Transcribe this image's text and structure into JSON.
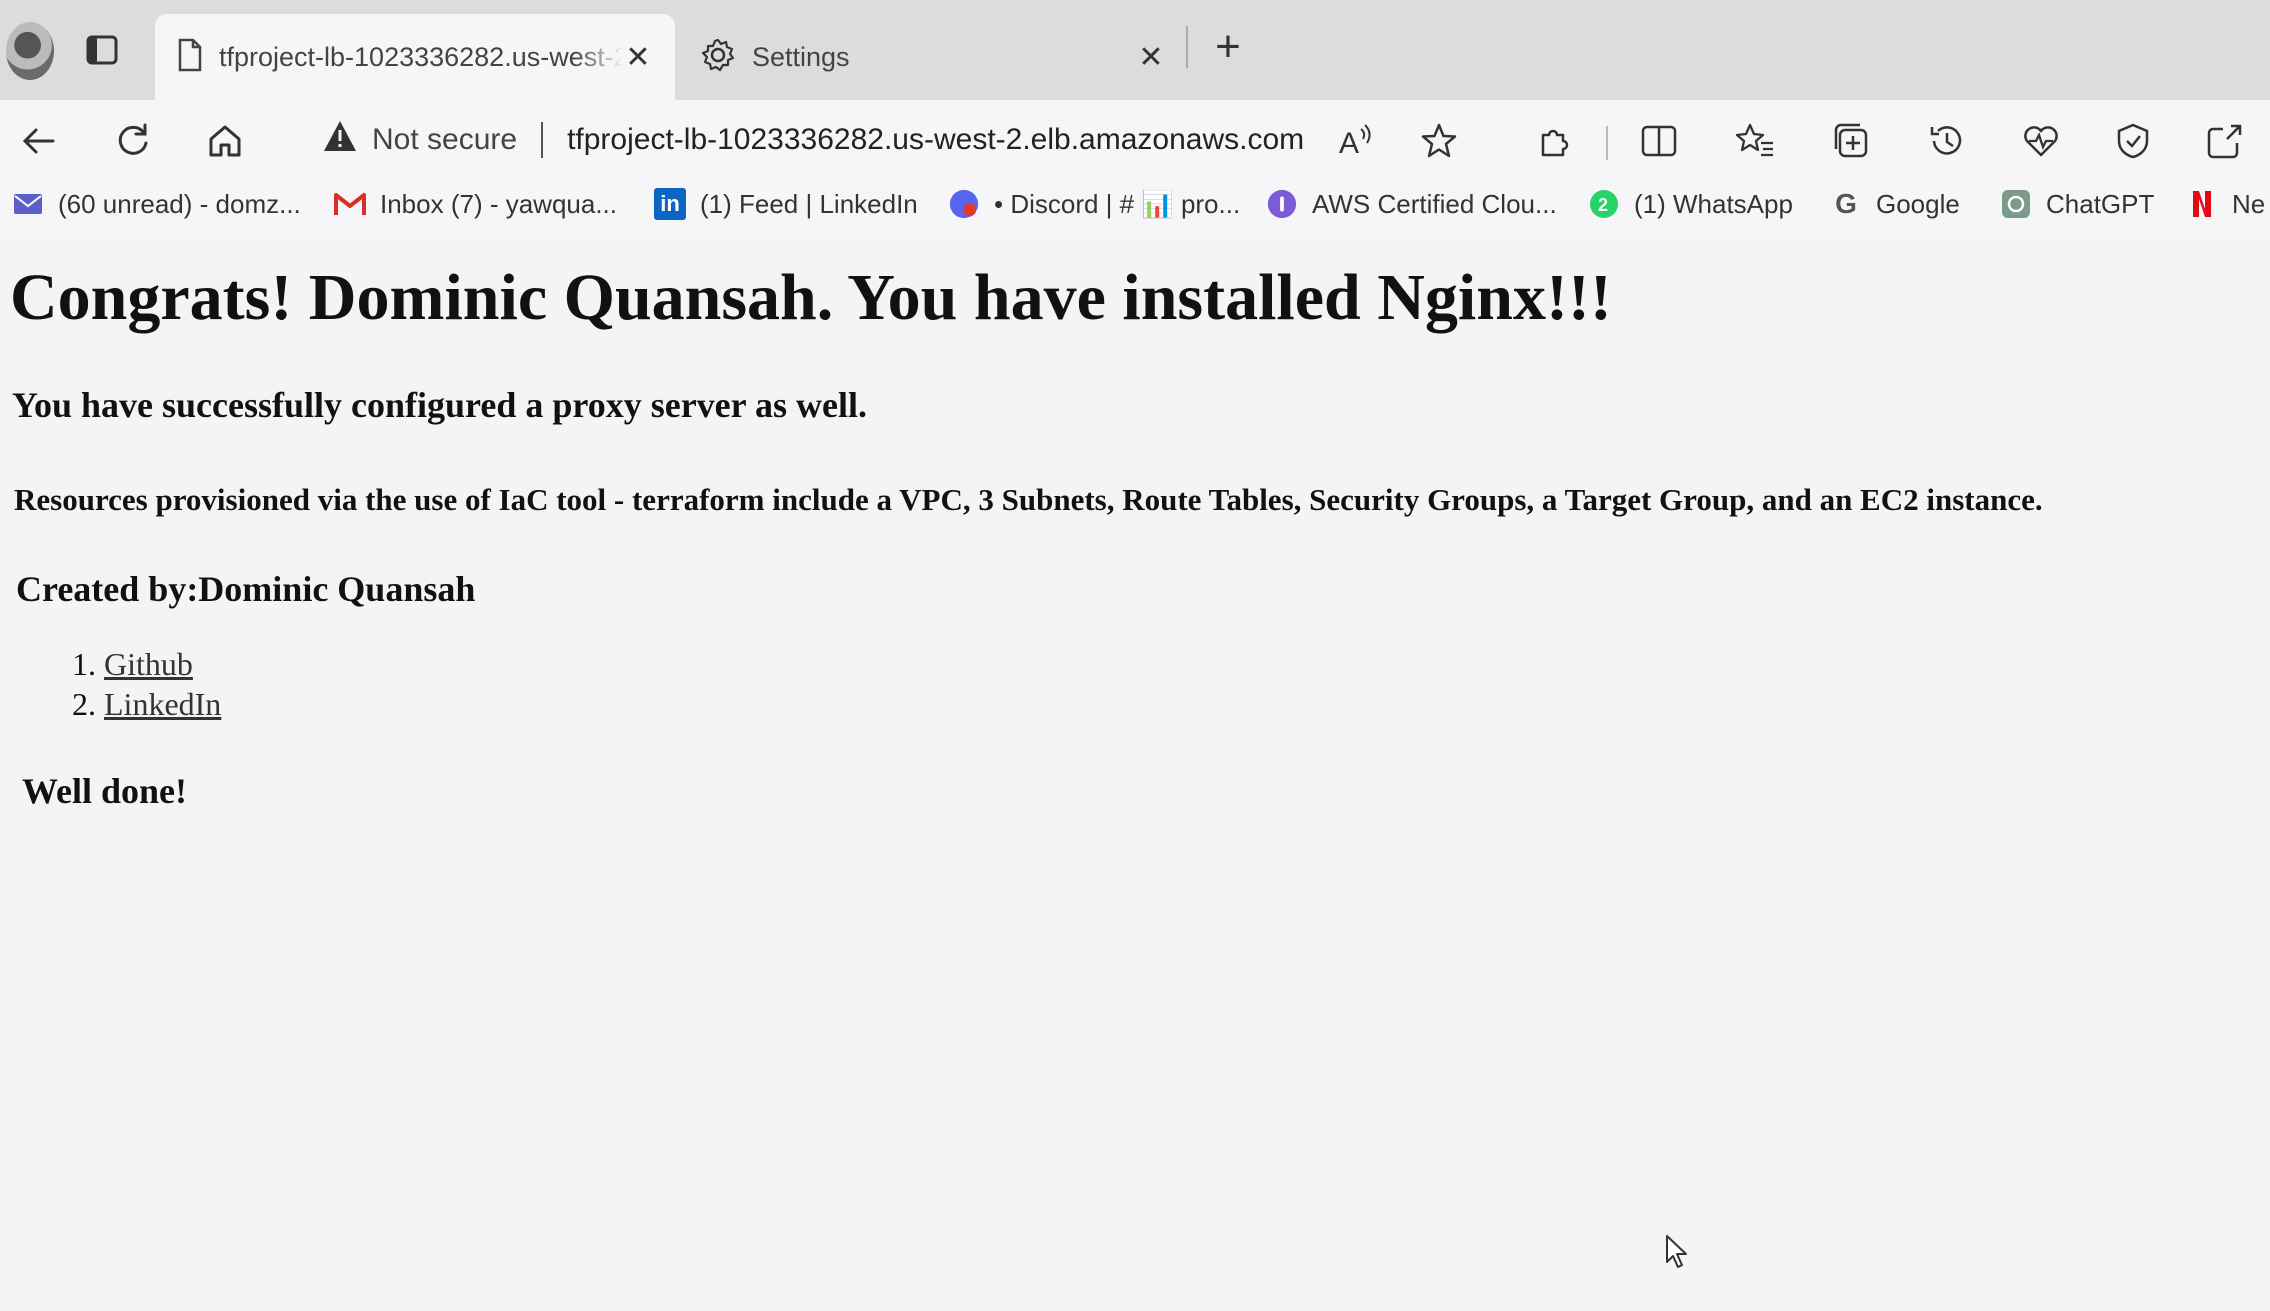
{
  "tabs": [
    {
      "title": "tfproject-lb-1023336282.us-west-2.elb.amazonaws.com",
      "active": true,
      "icon": "page-icon"
    },
    {
      "title": "Settings",
      "active": false,
      "icon": "gear-icon"
    }
  ],
  "new_tab_label": "+",
  "close_glyph": "✕",
  "addressbar": {
    "security_label": "Not secure",
    "url": "tfproject-lb-1023336282.us-west-2.elb.amazonaws.com"
  },
  "favorites": [
    {
      "label": "(60 unread) - domz...",
      "icon": "mail-icon",
      "color": "#5b5fc7"
    },
    {
      "label": "Inbox (7) - yawqua...",
      "icon": "gmail-icon",
      "color": "#d93025"
    },
    {
      "label": "(1) Feed | LinkedIn",
      "icon": "linkedin-icon",
      "color": "#0a66c2"
    },
    {
      "label": "• Discord | # 📊 pro...",
      "icon": "discord-icon",
      "color": "#5865f2"
    },
    {
      "label": "AWS Certified Clou...",
      "icon": "aws-course-icon",
      "color": "#7c5cd6"
    },
    {
      "label": "(1) WhatsApp",
      "icon": "whatsapp-icon",
      "color": "#25d366"
    },
    {
      "label": "Google",
      "icon": "google-icon",
      "color": "#4285f4"
    },
    {
      "label": "ChatGPT",
      "icon": "chatgpt-icon",
      "color": "#7a9a8a"
    },
    {
      "label": "Ne",
      "icon": "netflix-icon",
      "color": "#e50914"
    }
  ],
  "page": {
    "heading": "Congrats! Dominic Quansah. You have installed Nginx!!!",
    "subheading": "You have successfully configured a proxy server as well.",
    "resources": "Resources provisioned via the use of IaC tool - terraform include a VPC, 3 Subnets, Route Tables, Security Groups, a Target Group, and an EC2 instance.",
    "created_by": "Created by:Dominic Quansah",
    "links": [
      {
        "label": "Github"
      },
      {
        "label": "LinkedIn"
      }
    ],
    "closing": "Well done!"
  }
}
